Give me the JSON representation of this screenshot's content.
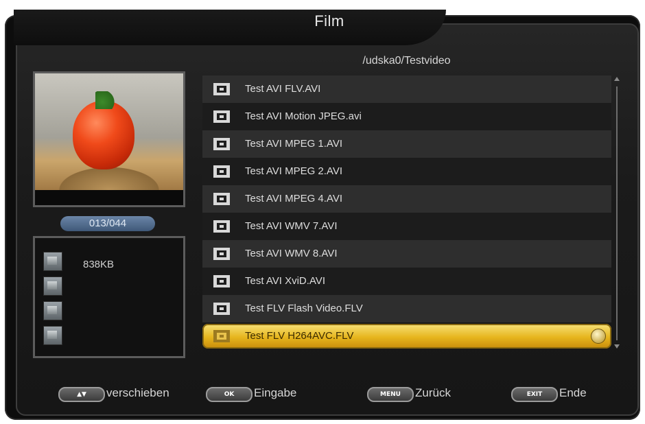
{
  "header": {
    "title": "Film",
    "path": "/udska0/Testvideo"
  },
  "preview": {
    "counter": "013/044",
    "file_size": "838KB"
  },
  "file_list": {
    "items": [
      {
        "label": "Test AVI FLV.AVI"
      },
      {
        "label": "Test AVI Motion JPEG.avi"
      },
      {
        "label": "Test AVI MPEG 1.AVI"
      },
      {
        "label": "Test AVI MPEG 2.AVI"
      },
      {
        "label": "Test AVI MPEG 4.AVI"
      },
      {
        "label": "Test AVI WMV 7.AVI"
      },
      {
        "label": "Test AVI WMV 8.AVI"
      },
      {
        "label": "Test AVI XviD.AVI"
      },
      {
        "label": "Test FLV Flash Video.FLV"
      },
      {
        "label": "Test FLV H264AVC.FLV"
      }
    ],
    "selected_index": 9
  },
  "footer": {
    "move_key": "▲▼",
    "move_label": "verschieben",
    "ok_key": "OK",
    "ok_label": "Eingabe",
    "menu_key": "MENU",
    "menu_label": "Zurück",
    "exit_key": "EXIT",
    "exit_label": "Ende"
  },
  "colors": {
    "highlight": "#e6b51d",
    "background": "#1b1b1b",
    "counter_pill": "#4f6a8c"
  }
}
